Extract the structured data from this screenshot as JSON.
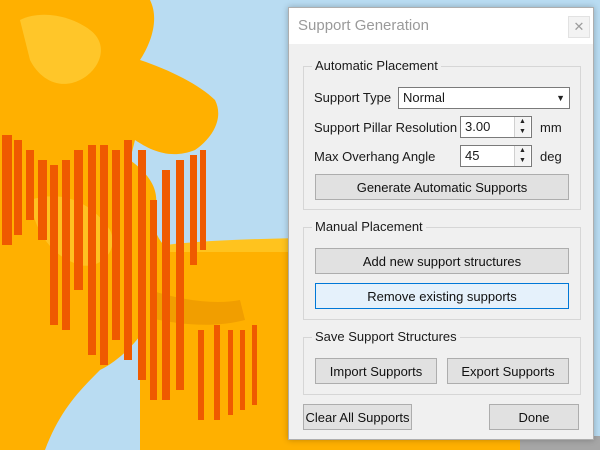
{
  "dialog": {
    "title": "Support Generation",
    "close_glyph": "✕",
    "automatic": {
      "legend": "Automatic Placement",
      "support_type_label": "Support Type",
      "support_type_value": "Normal",
      "pillar_resolution_label": "Support Pillar Resolution",
      "pillar_resolution_value": "3.00",
      "pillar_resolution_unit": "mm",
      "overhang_angle_label": "Max Overhang Angle",
      "overhang_angle_value": "45",
      "overhang_angle_unit": "deg",
      "generate_button": "Generate Automatic Supports"
    },
    "manual": {
      "legend": "Manual Placement",
      "add_button": "Add new support structures",
      "remove_button": "Remove existing supports"
    },
    "save": {
      "legend": "Save Support Structures",
      "import_button": "Import Supports",
      "export_button": "Export Supports"
    },
    "clear_button": "Clear All Supports",
    "done_button": "Done"
  },
  "icons": {
    "dropdown": "chevron-down-icon",
    "spinner_up": "up-arrow-icon",
    "spinner_down": "down-arrow-icon"
  },
  "colors": {
    "model": "#ffb000",
    "supports": "#ef5a00",
    "sky": "#b9dcf2",
    "accent": "#0078d7"
  }
}
